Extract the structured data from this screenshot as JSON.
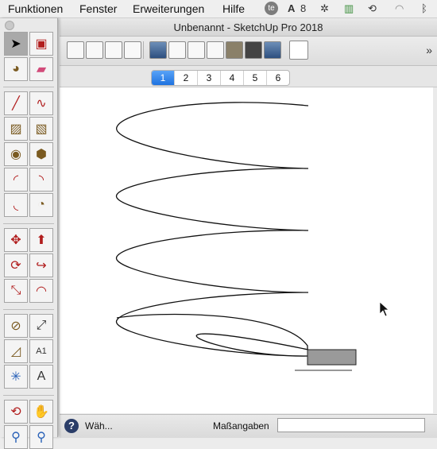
{
  "menubar": {
    "items": [
      "Funktionen",
      "Fenster",
      "Erweiterungen",
      "Hilfe"
    ],
    "tray_adobe_count": "8"
  },
  "window": {
    "title": "Unbenannt - SketchUp Pro 2018"
  },
  "toolbar": {
    "overflow": "»"
  },
  "scene_tabs": {
    "labels": [
      "1",
      "2",
      "3",
      "4",
      "5",
      "6"
    ],
    "active": "1"
  },
  "status": {
    "help": "?",
    "text": "Wäh...",
    "measurements_label": "Maßangaben",
    "measurements_value": ""
  },
  "colors": {
    "accent": "#1f73e0",
    "tool_red": "#b11d1d",
    "box_fill": "#9a9a9a"
  }
}
